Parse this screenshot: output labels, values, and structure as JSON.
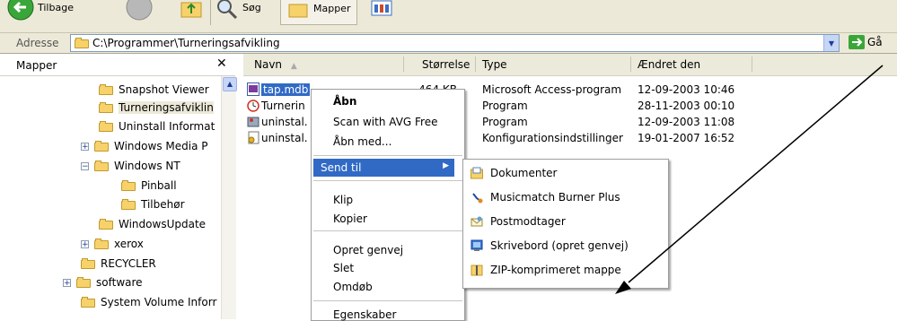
{
  "toolbar": {
    "back_label": "Tilbage",
    "search_label": "Søg",
    "folders_label": "Mapper"
  },
  "address": {
    "label": "Adresse",
    "path": "C:\\Programmer\\Turneringsafvikling",
    "go_label": "Gå"
  },
  "folders_pane": {
    "title": "Mapper",
    "close": "✕",
    "items": [
      {
        "label": "Snapshot Viewer",
        "expander": ""
      },
      {
        "label": "Turneringsafviklin",
        "expander": "",
        "selected": true
      },
      {
        "label": "Uninstall Informat",
        "expander": ""
      },
      {
        "label": "Windows Media P",
        "expander": "+"
      },
      {
        "label": "Windows NT",
        "expander": "−"
      },
      {
        "label": "Pinball",
        "expander": ""
      },
      {
        "label": "Tilbehør",
        "expander": ""
      },
      {
        "label": "WindowsUpdate",
        "expander": ""
      },
      {
        "label": "xerox",
        "expander": "+"
      },
      {
        "label": "RECYCLER",
        "expander": ""
      },
      {
        "label": "software",
        "expander": "+"
      },
      {
        "label": "System Volume Inforr",
        "expander": ""
      }
    ]
  },
  "list": {
    "columns": [
      "Navn",
      "Størrelse",
      "Type",
      "Ændret den"
    ],
    "sort_indicator": "▲",
    "rows": [
      {
        "name": "tap.mdb",
        "size": "464 KB",
        "type": "Microsoft Access-program",
        "modified": "12-09-2003 10:46",
        "icon": "access-db-icon"
      },
      {
        "name": "Turnerin",
        "size": "",
        "type": "Program",
        "modified": "28-11-2003 00:10",
        "icon": "clock-app-icon"
      },
      {
        "name": "uninstal.",
        "size": "",
        "type": "Program",
        "modified": "12-09-2003 11:08",
        "icon": "uninstall-app-icon"
      },
      {
        "name": "uninstal.",
        "size": "",
        "type": "Konfigurationsindstillinger",
        "modified": "19-01-2007 16:52",
        "icon": "config-file-icon"
      }
    ]
  },
  "context_menu": {
    "open": "Åbn",
    "scan": "Scan with AVG Free",
    "open_with": "Åbn med...",
    "send_to": "Send til",
    "cut": "Klip",
    "copy": "Kopier",
    "create_shortcut": "Opret genvej",
    "delete": "Slet",
    "rename": "Omdøb",
    "properties": "Egenskaber"
  },
  "send_to_menu": {
    "items": [
      {
        "label": "Dokumenter",
        "icon": "documents-folder-icon"
      },
      {
        "label": "Musicmatch Burner Plus",
        "icon": "musicmatch-icon"
      },
      {
        "label": "Postmodtager",
        "icon": "mail-recipient-icon"
      },
      {
        "label": "Skrivebord (opret genvej)",
        "icon": "desktop-icon"
      },
      {
        "label": "ZIP-komprimeret mappe",
        "icon": "zip-folder-icon"
      }
    ]
  },
  "colors": {
    "selection": "#316ac5",
    "toolbar_bg": "#ece9d8"
  }
}
